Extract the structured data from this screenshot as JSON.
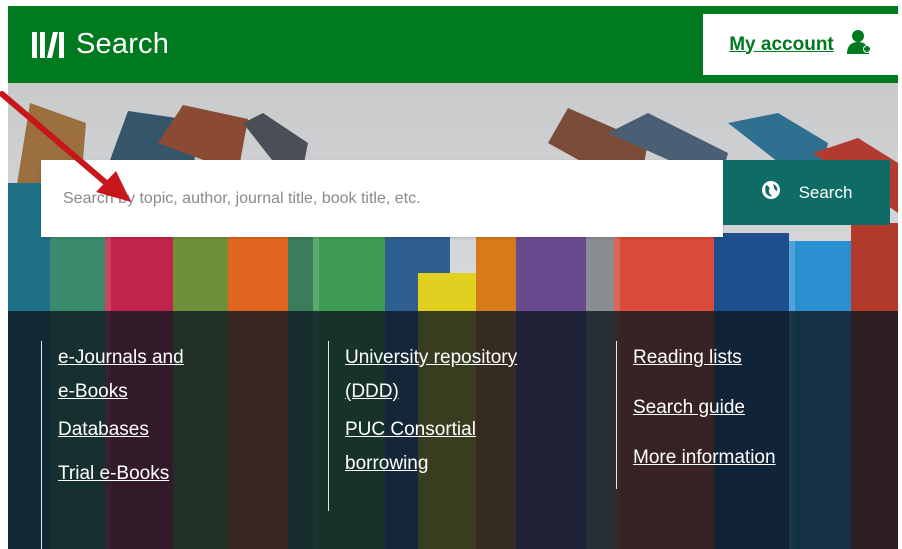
{
  "header": {
    "logo_text": "Search",
    "account_label": "My account",
    "account_icon": "user-icon",
    "background_color": "#007a1f"
  },
  "search": {
    "placeholder": "Search by topic, author, journal title, book title, etc.",
    "button_label": "Search",
    "button_icon": "globe-icon",
    "button_color": "#0e6b66"
  },
  "links": {
    "col1": {
      "ejournals": "e-Journals and",
      "ejournals_line2": "e-Books",
      "databases": "Databases",
      "trial_ebooks": "Trial e-Books"
    },
    "col2": {
      "repository": "University repository",
      "repository_line2": "(DDD)",
      "puc": "PUC Consortial",
      "puc_line2": "borrowing"
    },
    "col3": {
      "reading_lists": "Reading lists",
      "search_guide": "Search guide",
      "more_info": "More information"
    }
  },
  "annotation": {
    "color": "#c8161d"
  }
}
